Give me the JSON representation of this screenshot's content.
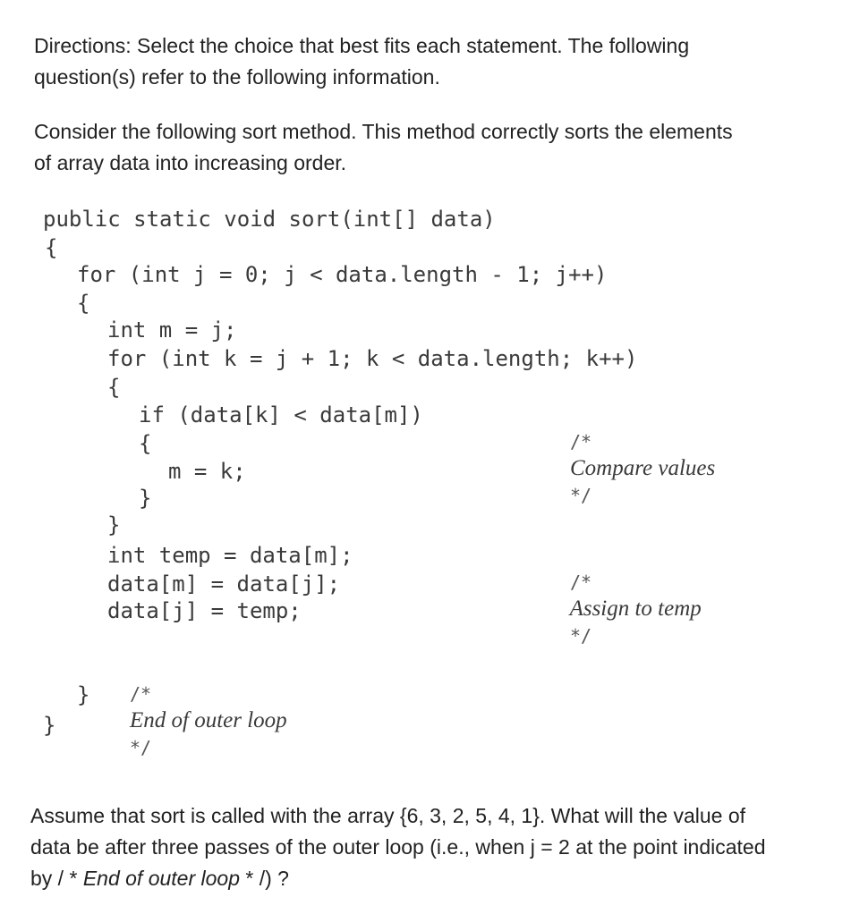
{
  "directions": {
    "line1": "Directions: Select the choice that best fits each statement. The following",
    "line2": "question(s) refer to the following information."
  },
  "intro": {
    "line1": "Consider the following sort method. This method correctly sorts the elements",
    "line2": "of array data into increasing order."
  },
  "code": {
    "l1": "public static void sort(int[] data)",
    "l2": "{",
    "l3": "for (int j = 0; j < data.length - 1; j++)",
    "l4": "{",
    "l5": "int m = j;",
    "l6": "for (int k = j + 1; k < data.length; k++)",
    "l7": "{",
    "l8": "if (data[k] < data[m])",
    "l9": "{",
    "l10": "m = k;",
    "l11": "}",
    "l12": "}",
    "l13": "int temp = data[m];",
    "l14": "data[m] = data[j];",
    "l15": "data[j] = temp;",
    "l16": "}",
    "l17": "}"
  },
  "comments": {
    "open": "/*",
    "close": "*/",
    "compare": "Compare values",
    "assign": "Assign to temp",
    "end_outer": "End of outer loop"
  },
  "question": {
    "line1": "Assume that sort is called with the array {6, 3, 2, 5, 4, 1}. What will the value of",
    "line2": "data be after three passes of the outer loop (i.e., when j = 2 at the point indicated",
    "line3_prefix": "by / * ",
    "line3_italic": "End of outer loop",
    "line3_suffix": " * /) ?"
  }
}
